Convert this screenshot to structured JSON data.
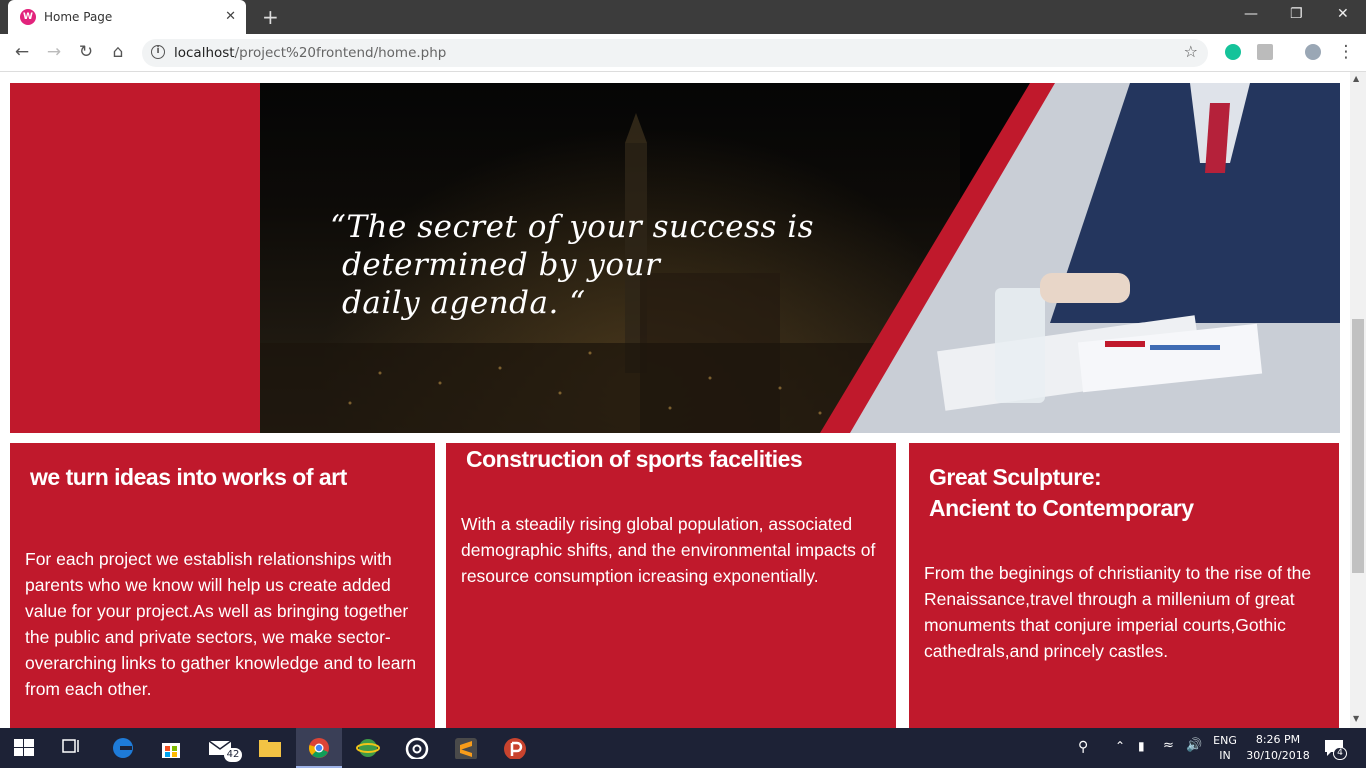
{
  "browser": {
    "tab_title": "Home Page",
    "new_tab": "+",
    "url_host": "localhost",
    "url_path": "/project%20frontend/home.php"
  },
  "banner": {
    "quote_line1": "“The secret of your success is",
    "quote_line2": "determined by your",
    "quote_line3": "daily agenda. “"
  },
  "cards": [
    {
      "title": "we turn ideas into works of art",
      "body": "For each project we establish relationships with parents who we know will help us create added value for your project.As well as bringing together the public and private sectors, we make sector-overarching links to gather knowledge and to learn from each other."
    },
    {
      "title": "Construction of sports facelities",
      "body": "With a steadily rising global population, associated demographic shifts, and the environmental impacts of resource consumption icreasing exponentially."
    },
    {
      "title_line1": "Great Sculpture:",
      "title_line2": "Ancient to Contemporary",
      "body": "From the beginings of christianity to the rise of the Renaissance,travel through a millenium of great monuments that conjure imperial courts,Gothic cathedrals,and princely castles."
    }
  ],
  "taskbar": {
    "mail_badge": "42",
    "lang_line1": "ENG",
    "lang_line2": "IN",
    "time": "8:26 PM",
    "date": "30/10/2018",
    "notif_badge": "4"
  },
  "colors": {
    "brand_red": "#c0192c",
    "tab_strip": "#3c3c3c",
    "taskbar": "#1d2236"
  }
}
